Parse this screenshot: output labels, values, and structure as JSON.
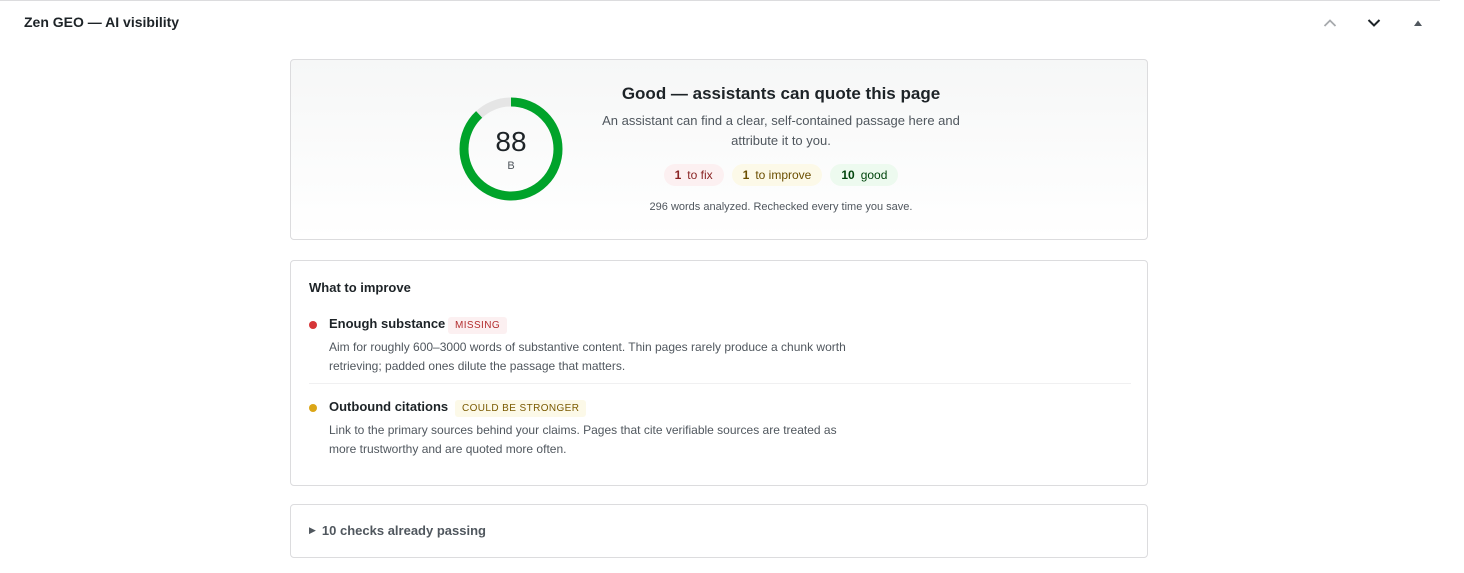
{
  "panel": {
    "title": "Zen GEO — AI visibility",
    "actions": [
      "chevron-up-icon",
      "chevron-down-icon",
      "caret-up-icon"
    ]
  },
  "score": {
    "value": "88",
    "percent": 88,
    "grade": "B",
    "verdict": "Good — assistants can quote this page",
    "summary": "An assistant can find a clear, self-contained passage here and attribute it to you.",
    "pills": {
      "fix": {
        "count": "1",
        "label": "to fix"
      },
      "improve": {
        "count": "1",
        "label": "to improve"
      },
      "good": {
        "count": "10",
        "label": "good"
      }
    },
    "analyzed": "296 words analyzed. Rechecked every time you save."
  },
  "improve": {
    "title": "What to improve",
    "items": [
      {
        "name": "Enough substance",
        "tag": "MISSING",
        "description": "Aim for roughly 600–3000 words of substantive content. Thin pages rarely produce a chunk worth retrieving; padded ones dilute the passage that matters."
      },
      {
        "name": "Outbound citations",
        "tag": "COULD BE STRONGER",
        "description": "Link to the primary sources behind your claims. Pages that cite verifiable sources are treated as more trustworthy and are quoted more often."
      }
    ]
  },
  "passing": {
    "label": "10 checks already passing"
  },
  "colors": {
    "good": "#00a32a",
    "track": "#e5e5e5",
    "missing": "#d63638",
    "warning": "#dba617"
  }
}
